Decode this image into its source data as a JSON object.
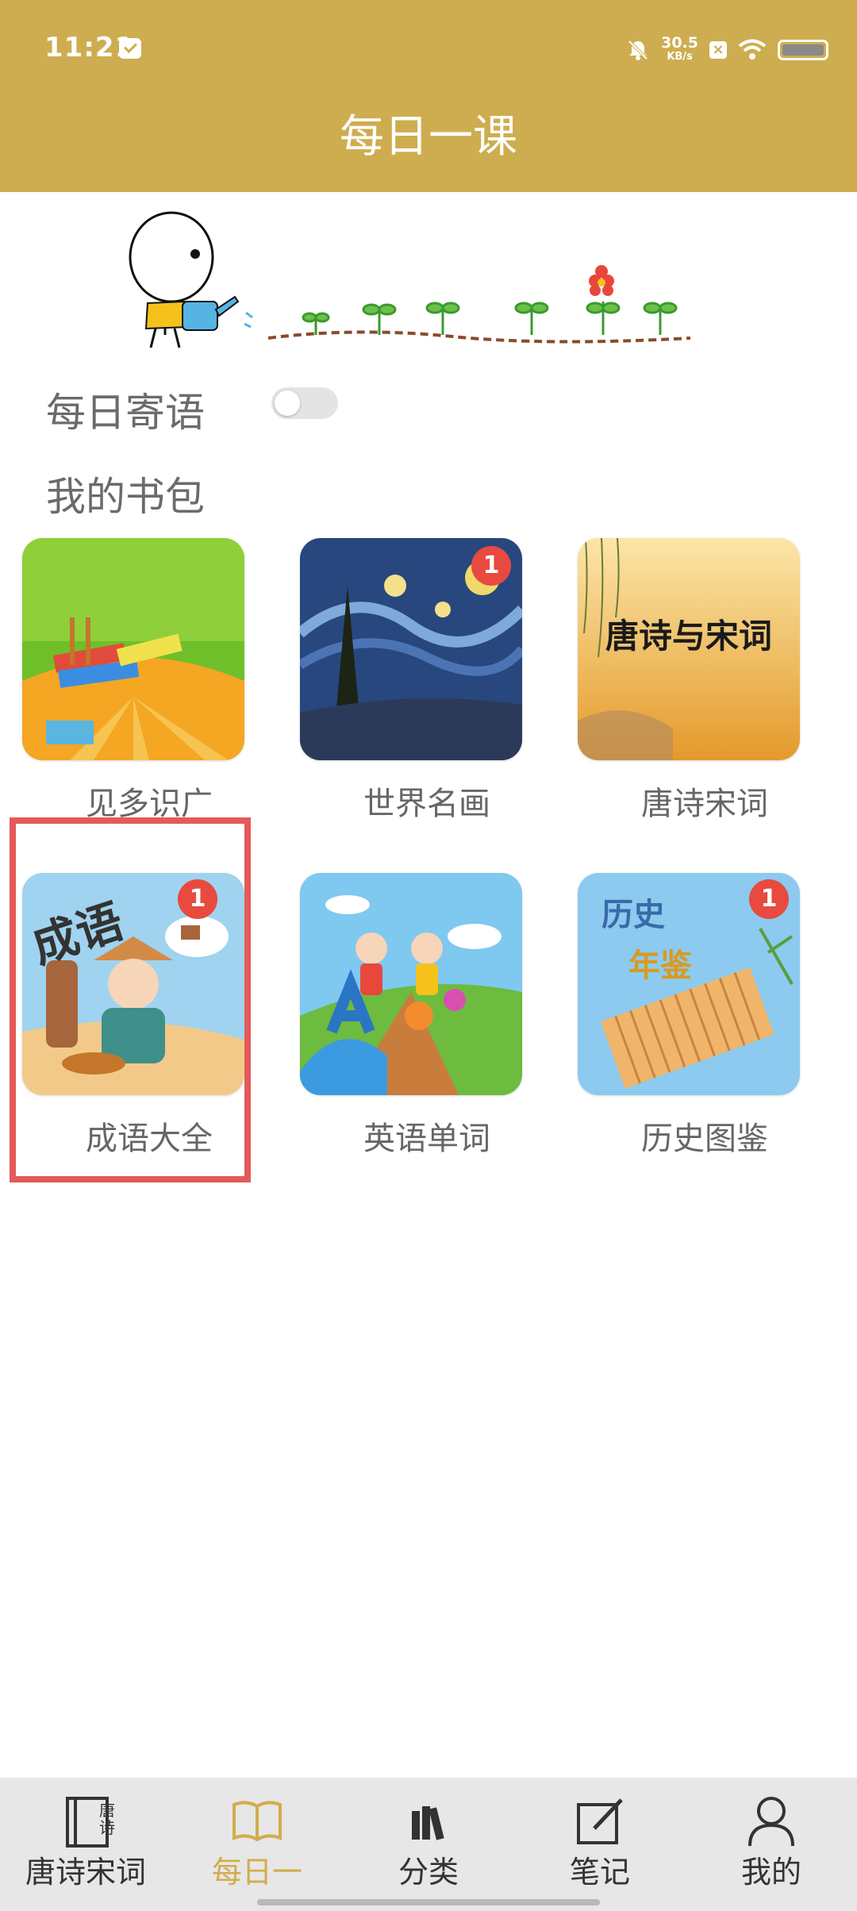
{
  "status_bar": {
    "time": "11:21",
    "speed_value": "30.5",
    "speed_unit": "KB/s"
  },
  "header": {
    "title": "每日一课"
  },
  "daily_quote": {
    "label": "每日寄语",
    "enabled": false
  },
  "bookbag": {
    "title": "我的书包",
    "items": [
      {
        "label": "见多识广",
        "badge": ""
      },
      {
        "label": "世界名画",
        "badge": "1"
      },
      {
        "label": "唐诗宋词",
        "badge": "",
        "cover_text": "唐诗与宋词"
      },
      {
        "label": "成语大全",
        "badge": "1",
        "cover_text": "成语"
      },
      {
        "label": "英语单词",
        "badge": ""
      },
      {
        "label": "历史图鉴",
        "badge": "1",
        "cover_text_1": "历史",
        "cover_text_2": "年鉴"
      }
    ]
  },
  "bottom_nav": {
    "active_index": 1,
    "items": [
      {
        "label": "唐诗宋词",
        "icon": "poetry-book-icon",
        "icon_text_1": "唐",
        "icon_text_2": "诗"
      },
      {
        "label": "每日一",
        "icon": "open-book-icon"
      },
      {
        "label": "分类",
        "icon": "books-icon"
      },
      {
        "label": "笔记",
        "icon": "note-edit-icon"
      },
      {
        "label": "我的",
        "icon": "person-icon"
      }
    ]
  },
  "colors": {
    "header": "#cead50",
    "badge": "#e84a3f",
    "active_nav": "#d3ac4c",
    "highlight": "#e45a5a"
  }
}
